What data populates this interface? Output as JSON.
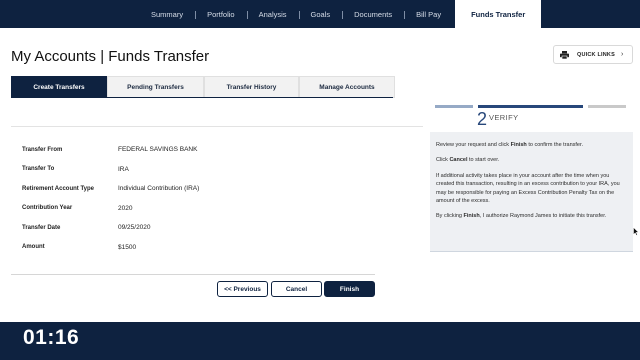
{
  "topnav": {
    "items": [
      "Summary",
      "Portfolio",
      "Analysis",
      "Goals",
      "Documents",
      "Bill Pay"
    ],
    "active": "Funds Transfer"
  },
  "header": {
    "title": "My Accounts | Funds Transfer",
    "quick_links_label": "QUICK LINKS",
    "quick_links_icon": "printer-icon"
  },
  "tabs": [
    "Create Transfers",
    "Pending Transfers",
    "Transfer History",
    "Manage Accounts"
  ],
  "details": [
    {
      "label": "Transfer From",
      "value": "FEDERAL SAVINGS BANK"
    },
    {
      "label": "Transfer To",
      "value": "IRA"
    },
    {
      "label": "Retirement Account Type",
      "value": "Individual Contribution (IRA)"
    },
    {
      "label": "Contribution Year",
      "value": "2020"
    },
    {
      "label": "Transfer Date",
      "value": "09/25/2020"
    },
    {
      "label": "Amount",
      "value": "$1500"
    }
  ],
  "buttons": {
    "previous": "<< Previous",
    "cancel": "Cancel",
    "finish": "Finish"
  },
  "step": {
    "number": "2",
    "label": "VERIFY"
  },
  "info": {
    "p1_pre": "Review your request and click ",
    "p1_bold": "Finish",
    "p1_post": " to confirm the transfer.",
    "p2_pre": "Click ",
    "p2_bold": "Cancel",
    "p2_post": " to start over.",
    "p3": "If additional activity takes place in your account after the time when you created this transaction, resulting in an excess contribution to your IRA, you may be responsible for paying an Excess Contribution Penalty Tax on the amount of the excess.",
    "p4_pre": "By clicking ",
    "p4_bold": "Finish",
    "p4_post": ", I authorize Raymond James to initiate this transfer."
  },
  "timer": "01:16",
  "colors": {
    "navy": "#0e2240",
    "step_active": "#27477a",
    "panel_bg": "#eef0f3"
  }
}
